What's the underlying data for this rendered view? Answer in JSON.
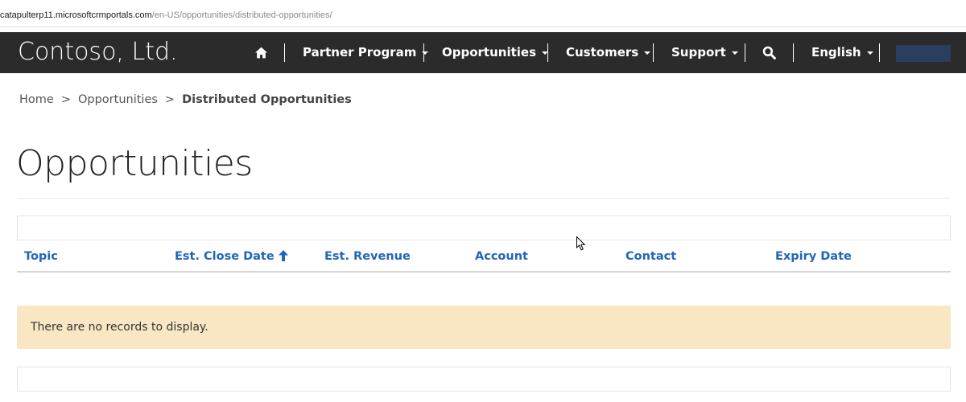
{
  "browser": {
    "url_host": "catapulterp11.microsoftcrmportals.com",
    "url_path": "/en-US/opportunities/distributed-opportunities/"
  },
  "navbar": {
    "brand": "Contoso, Ltd.",
    "home_icon": "home-icon",
    "items": [
      {
        "label": "Partner Program"
      },
      {
        "label": "Opportunities"
      },
      {
        "label": "Customers"
      },
      {
        "label": "Support"
      }
    ],
    "search_icon": "search-icon",
    "language": "English",
    "user_box_color": "#2c3e5f"
  },
  "breadcrumb": {
    "items": [
      "Home",
      "Opportunities"
    ],
    "current": "Distributed Opportunities",
    "separator": ">"
  },
  "page": {
    "title": "Opportunities"
  },
  "grid": {
    "columns": [
      {
        "label": "Topic"
      },
      {
        "label": "Est. Close Date",
        "sort": "ascending"
      },
      {
        "label": "Est. Revenue"
      },
      {
        "label": "Account"
      },
      {
        "label": "Contact"
      },
      {
        "label": "Expiry Date"
      }
    ],
    "empty_message": "There are no records to display."
  },
  "colors": {
    "nav_background": "#2b2b2b",
    "link_blue": "#2266b9",
    "empty_background": "#f9e7c4"
  }
}
